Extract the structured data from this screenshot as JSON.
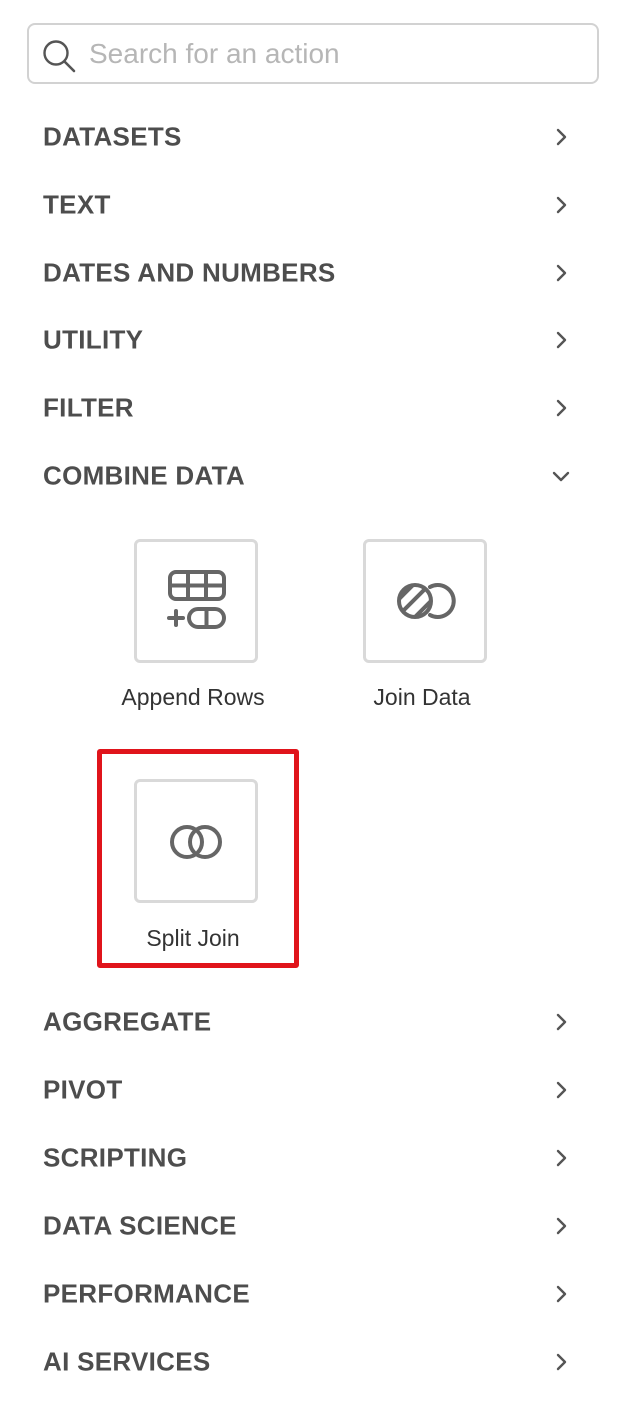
{
  "search": {
    "placeholder": "Search for an action",
    "value": ""
  },
  "categories_top": [
    {
      "label": "DATASETS",
      "state": "collapsed"
    },
    {
      "label": "TEXT",
      "state": "collapsed"
    },
    {
      "label": "DATES AND NUMBERS",
      "state": "collapsed"
    },
    {
      "label": "UTILITY",
      "state": "collapsed"
    },
    {
      "label": "FILTER",
      "state": "collapsed"
    },
    {
      "label": "COMBINE DATA",
      "state": "expanded"
    }
  ],
  "combine_data_actions": [
    {
      "label": "Append Rows",
      "icon": "append-rows-icon"
    },
    {
      "label": "Join Data",
      "icon": "join-data-icon"
    },
    {
      "label": "Split Join",
      "icon": "split-join-icon",
      "highlighted": true
    }
  ],
  "categories_bottom": [
    {
      "label": "AGGREGATE",
      "state": "collapsed"
    },
    {
      "label": "PIVOT",
      "state": "collapsed"
    },
    {
      "label": "SCRIPTING",
      "state": "collapsed"
    },
    {
      "label": "DATA SCIENCE",
      "state": "collapsed"
    },
    {
      "label": "PERFORMANCE",
      "state": "collapsed"
    },
    {
      "label": "AI SERVICES",
      "state": "collapsed"
    }
  ],
  "colors": {
    "highlight": "#e0141b",
    "text": "#4d4d4d",
    "icon": "#666666",
    "border": "#d9d9d9"
  }
}
